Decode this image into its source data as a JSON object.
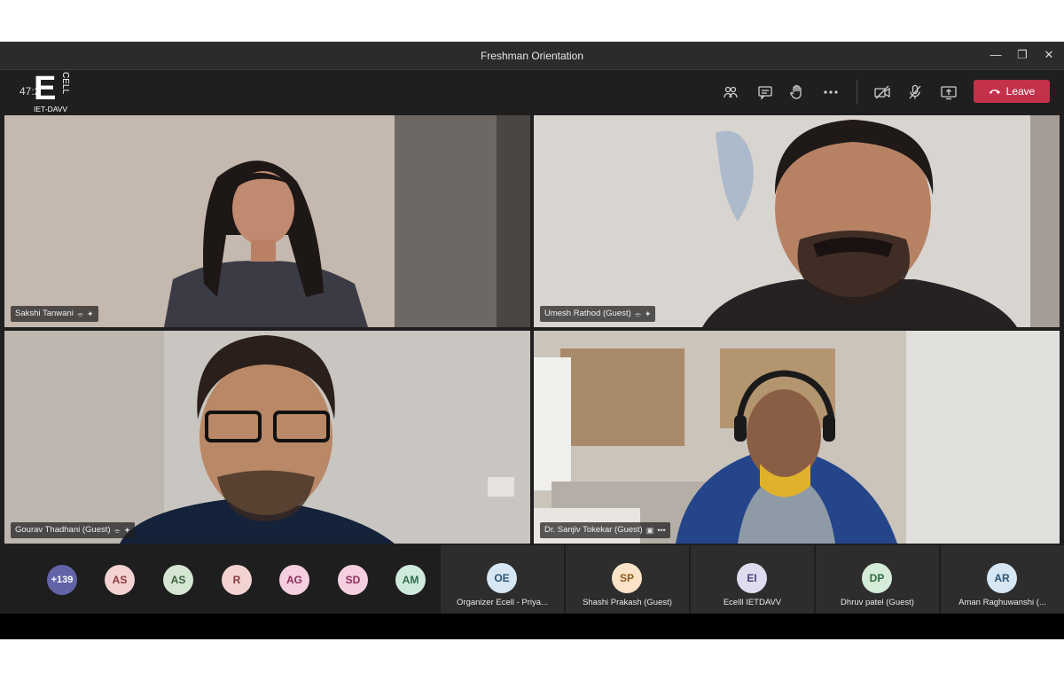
{
  "window": {
    "title": "Freshman Orientation"
  },
  "toolbar": {
    "timer": "47:2",
    "logo": {
      "letter": "E",
      "vertical_text": "CELL",
      "caption": "IET-DAVV"
    },
    "leave_label": "Leave",
    "icons": [
      "participants-icon",
      "chat-icon",
      "raise-hand-icon",
      "more-icon",
      "camera-off-icon",
      "mic-off-icon",
      "share-screen-icon"
    ]
  },
  "tiles": [
    {
      "name": "Sakshi Tanwani"
    },
    {
      "name": "Umesh Rathod (Guest)"
    },
    {
      "name": "Gourav Thadhani (Guest)"
    },
    {
      "name": "Dr. Sanjiv Tokekar (Guest)"
    }
  ],
  "roster": {
    "overflow": "+139",
    "avatars": [
      {
        "initials": "AS",
        "bg": "#f3d2d2",
        "fg": "#8a3a3a"
      },
      {
        "initials": "AS",
        "bg": "#d5e6d3",
        "fg": "#3d5e3a"
      },
      {
        "initials": "R",
        "bg": "#f3d2d2",
        "fg": "#8a3a3a"
      },
      {
        "initials": "AG",
        "bg": "#f5cfe0",
        "fg": "#8c2e5c"
      },
      {
        "initials": "SD",
        "bg": "#f5cfe0",
        "fg": "#8c2e5c"
      },
      {
        "initials": "AM",
        "bg": "#cfeadc",
        "fg": "#2f6b4a"
      }
    ],
    "cards": [
      {
        "initials": "OE",
        "name": "Organizer Ecell - Priya...",
        "bg": "#d6e6f2",
        "fg": "#2c5574"
      },
      {
        "initials": "SP",
        "name": "Shashi Prakash (Guest)",
        "bg": "#fbe3c8",
        "fg": "#8a5a1e"
      },
      {
        "initials": "EI",
        "name": "Ecelll IETDAVV",
        "bg": "#e0dcf0",
        "fg": "#4b3f7a"
      },
      {
        "initials": "DP",
        "name": "Dhruv patel (Guest)",
        "bg": "#d5ecd8",
        "fg": "#2f6b3c"
      },
      {
        "initials": "AR",
        "name": "Aman Raghuwanshi (...",
        "bg": "#d6e6f2",
        "fg": "#2c5574"
      }
    ]
  },
  "colors": {
    "leave": "#c4314b",
    "overflow_avatar": "#6264a7"
  }
}
